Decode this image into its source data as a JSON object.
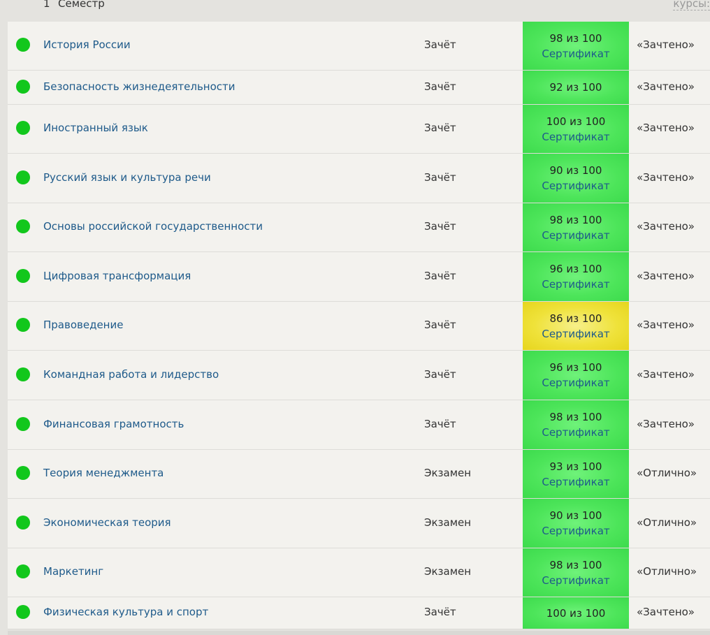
{
  "semester": {
    "number": "1",
    "label": "Семестр",
    "courses_link": "курсы:"
  },
  "rows": [
    {
      "name": "История России",
      "control": "Зачёт",
      "score": "98 из 100",
      "cert": "Сертификат",
      "grade": "«Зачтено»",
      "color": "green"
    },
    {
      "name": "Безопасность жизнедеятельности",
      "control": "Зачёт",
      "score": "92 из 100",
      "cert": "",
      "grade": "«Зачтено»",
      "color": "green"
    },
    {
      "name": "Иностранный язык",
      "control": "Зачёт",
      "score": "100 из 100",
      "cert": "Сертификат",
      "grade": "«Зачтено»",
      "color": "green"
    },
    {
      "name": "Русский язык и культура речи",
      "control": "Зачёт",
      "score": "90 из 100",
      "cert": "Сертификат",
      "grade": "«Зачтено»",
      "color": "green"
    },
    {
      "name": "Основы российской государственности",
      "control": "Зачёт",
      "score": "98 из 100",
      "cert": "Сертификат",
      "grade": "«Зачтено»",
      "color": "green"
    },
    {
      "name": "Цифровая трансформация",
      "control": "Зачёт",
      "score": "96 из 100",
      "cert": "Сертификат",
      "grade": "«Зачтено»",
      "color": "green"
    },
    {
      "name": "Правоведение",
      "control": "Зачёт",
      "score": "86 из 100",
      "cert": "Сертификат",
      "grade": "«Зачтено»",
      "color": "yellow"
    },
    {
      "name": "Командная работа и лидерство",
      "control": "Зачёт",
      "score": "96 из 100",
      "cert": "Сертификат",
      "grade": "«Зачтено»",
      "color": "green"
    },
    {
      "name": "Финансовая грамотность",
      "control": "Зачёт",
      "score": "98 из 100",
      "cert": "Сертификат",
      "grade": "«Зачтено»",
      "color": "green"
    },
    {
      "name": "Теория менеджмента",
      "control": "Экзамен",
      "score": "93 из 100",
      "cert": "Сертификат",
      "grade": "«Отлично»",
      "color": "green"
    },
    {
      "name": "Экономическая теория",
      "control": "Экзамен",
      "score": "90 из 100",
      "cert": "Сертификат",
      "grade": "«Отлично»",
      "color": "green"
    },
    {
      "name": "Маркетинг",
      "control": "Экзамен",
      "score": "98 из 100",
      "cert": "Сертификат",
      "grade": "«Отлично»",
      "color": "green"
    },
    {
      "name": "Физическая культура и спорт",
      "control": "Зачёт",
      "score": "100 из 100",
      "cert": "",
      "grade": "«Зачтено»",
      "color": "green"
    }
  ]
}
